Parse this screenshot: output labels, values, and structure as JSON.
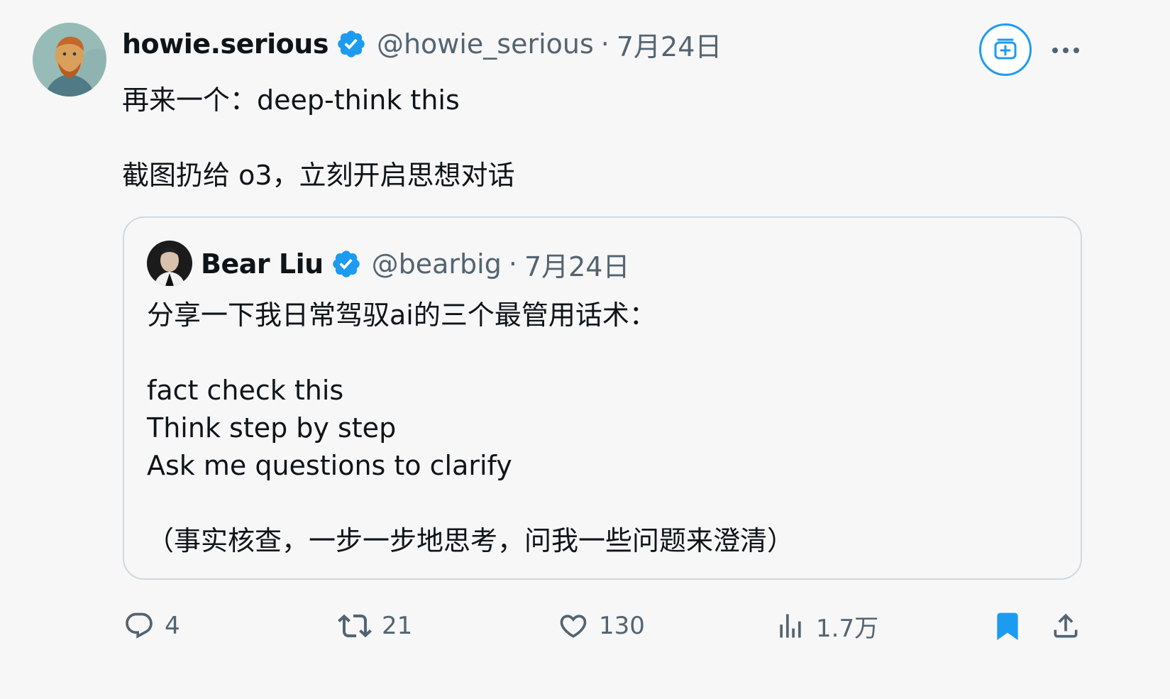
{
  "tweet": {
    "author": {
      "name": "howie.serious",
      "handle": "@howie_serious",
      "avatar": "van-gogh-portrait-avatar"
    },
    "separator": "·",
    "date": "7月24日",
    "lines": [
      "再来一个：deep-think this",
      "截图扔给 o3，立刻开启思想对话"
    ]
  },
  "quoted": {
    "author": {
      "name": "Bear Liu",
      "handle": "@bearbig",
      "avatar": "person-photo-avatar"
    },
    "separator": "·",
    "date": "7月24日",
    "lines": [
      "分享一下我日常驾驭ai的三个最管用话术：",
      "fact check this",
      "Think step by step",
      "Ask me questions to clarify",
      "（事实核查，一步一步地思考，问我一些问题来澄清）"
    ]
  },
  "actions": {
    "reply": {
      "icon": "reply-icon",
      "count": "4"
    },
    "retweet": {
      "icon": "retweet-icon",
      "count": "21"
    },
    "like": {
      "icon": "heart-icon",
      "count": "130"
    },
    "views": {
      "icon": "views-icon",
      "count": "1.7万"
    },
    "bookmark": {
      "icon": "bookmark-icon"
    },
    "share": {
      "icon": "share-icon"
    }
  },
  "colors": {
    "accent": "#1d9bf0",
    "text": "#0f1419",
    "secondary": "#536471",
    "border": "#cfd9de"
  }
}
